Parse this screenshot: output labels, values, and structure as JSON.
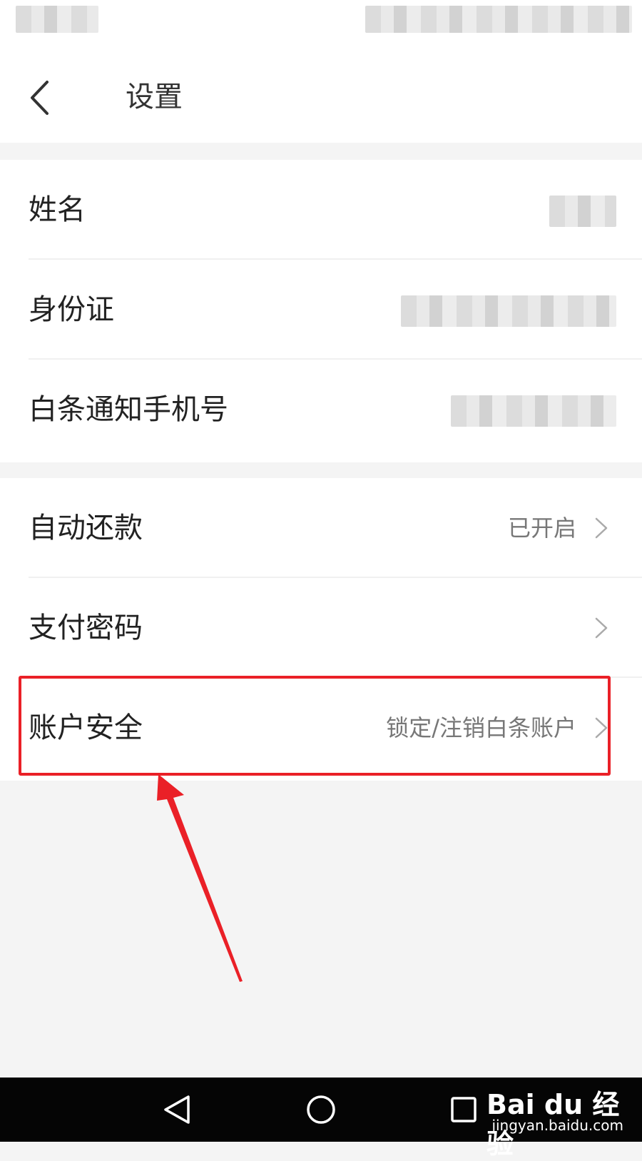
{
  "header": {
    "title": "设置"
  },
  "personal_info": {
    "items": [
      {
        "label": "姓名"
      },
      {
        "label": "身份证"
      },
      {
        "label": "白条通知手机号"
      }
    ]
  },
  "settings": {
    "items": [
      {
        "label": "自动还款",
        "value": "已开启"
      },
      {
        "label": "支付密码",
        "value": ""
      },
      {
        "label": "账户安全",
        "value": "锁定/注销白条账户"
      }
    ]
  },
  "watermark": {
    "logo": "Bai du 经验",
    "url": "jingyan.baidu.com"
  },
  "colors": {
    "highlight": "#ea2027",
    "background": "#f4f4f4",
    "navbar": "#050505"
  }
}
